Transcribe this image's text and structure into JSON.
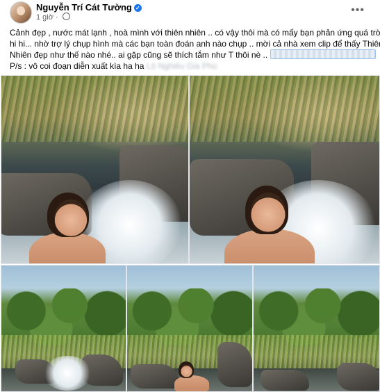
{
  "post": {
    "author": "Nguyễn Trí Cát Tường",
    "time": "1 giờ",
    "line1": "Cảnh đẹp , nước mát lạnh , hoà mình với thiên nhiên .. có vậy thôi mà có mấy bạn phản ứng quá trời",
    "line2": "hi hi... nhờ trợ lý chụp hình mà các bạn toàn đoán anh nào chụp .. mời cả nhà xem clip để thấy Thiên",
    "line3": "Nhiên đẹp như thế nào nhé.. ai gặp cũng sẽ thích tắm như T thôi nè ..",
    "line4": "P/s : vô coi đoạn diễn xuất kìa ha ha",
    "blurred_tag": "Lộ Nghiêu Gia Phú"
  },
  "icons": {
    "verified": "verified-badge-icon",
    "privacy": "globe-icon",
    "more": "more-options-icon"
  },
  "colors": {
    "verified": "#1877f2",
    "secondary_text": "#65676b"
  }
}
